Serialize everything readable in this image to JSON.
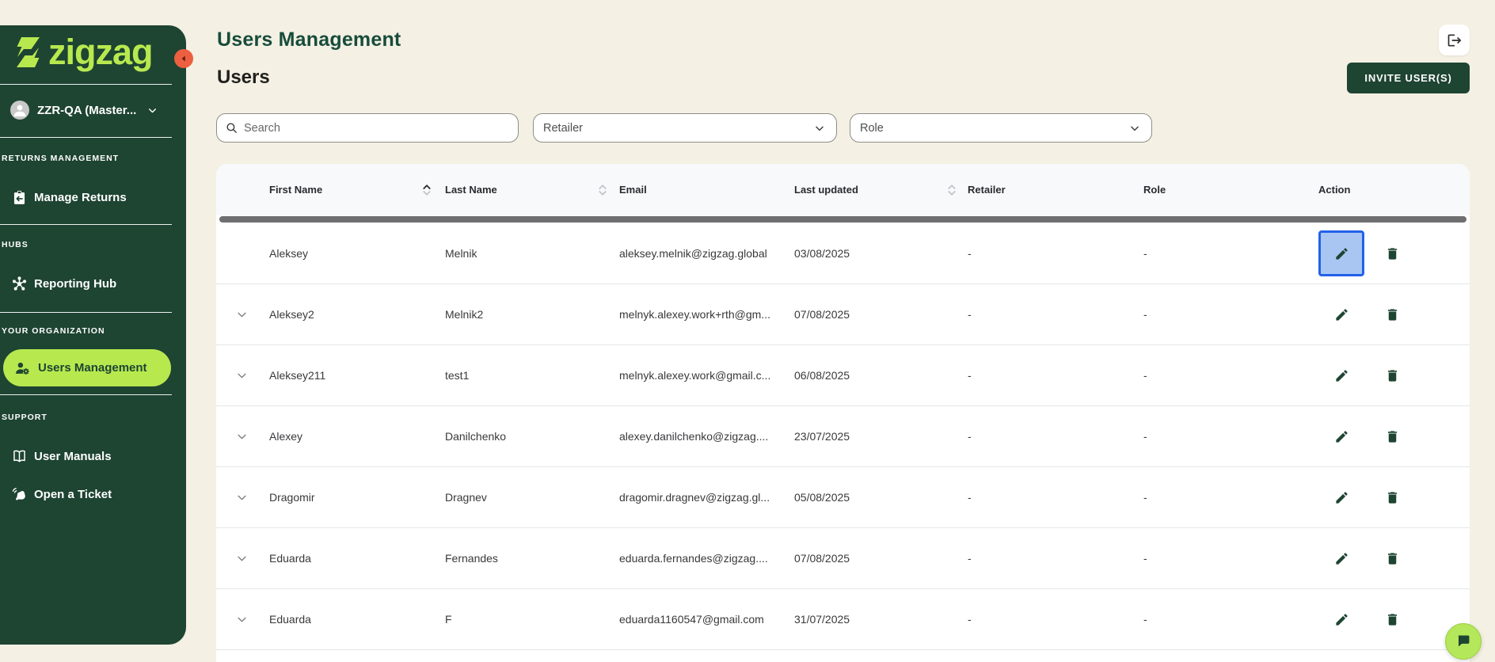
{
  "colors": {
    "sidebar_green": "#1e4432",
    "accent_green": "#b7e94f",
    "cream_bg": "#f4f0e3",
    "orange_collapse": "#ec5f41",
    "highlight_blue_border": "#2261e9",
    "highlight_blue_fill": "#a9c6f2",
    "title_green": "#174c3c"
  },
  "sidebar": {
    "logo_text": "zigzag",
    "account": {
      "name": "ZZR-QA (Master..."
    },
    "sections": [
      {
        "label": "RETURNS MANAGEMENT",
        "items": [
          {
            "label": "Manage Returns",
            "icon": "returns-box-icon",
            "active": false
          }
        ]
      },
      {
        "label": "HUBS",
        "items": [
          {
            "label": "Reporting Hub",
            "icon": "hub-icon",
            "active": false
          }
        ]
      },
      {
        "label": "YOUR ORGANIZATION",
        "items": [
          {
            "label": "Users Management",
            "icon": "user-gear-icon",
            "active": true
          }
        ]
      },
      {
        "label": "SUPPORT",
        "items": [
          {
            "label": "User Manuals",
            "icon": "book-icon",
            "active": false
          },
          {
            "label": "Open a Ticket",
            "icon": "ticket-icon",
            "active": false
          }
        ]
      }
    ]
  },
  "header": {
    "title": "Users Management",
    "subtitle": "Users",
    "invite_button": "INVITE USER(S)"
  },
  "filters": {
    "search_placeholder": "Search",
    "retailer_label": "Retailer",
    "role_label": "Role"
  },
  "table": {
    "columns": [
      {
        "label": "First Name",
        "sortable": true,
        "sort": "asc"
      },
      {
        "label": "Last Name",
        "sortable": true,
        "sort": "none"
      },
      {
        "label": "Email",
        "sortable": false,
        "sort": "none"
      },
      {
        "label": "Last updated",
        "sortable": true,
        "sort": "none"
      },
      {
        "label": "Retailer",
        "sortable": false,
        "sort": "none"
      },
      {
        "label": "Role",
        "sortable": false,
        "sort": "none"
      },
      {
        "label": "Action",
        "sortable": false,
        "sort": "none"
      }
    ],
    "rows": [
      {
        "first": "Aleksey",
        "last": "Melnik",
        "email": "aleksey.melnik@zigzag.global",
        "updated": "03/08/2025",
        "retailer": "-",
        "role": "-",
        "expandable": false,
        "edit_highlighted": true
      },
      {
        "first": "Aleksey2",
        "last": "Melnik2",
        "email": "melnyk.alexey.work+rth@gm...",
        "updated": "07/08/2025",
        "retailer": "-",
        "role": "-",
        "expandable": true,
        "edit_highlighted": false
      },
      {
        "first": "Aleksey211",
        "last": "test1",
        "email": "melnyk.alexey.work@gmail.c...",
        "updated": "06/08/2025",
        "retailer": "-",
        "role": "-",
        "expandable": true,
        "edit_highlighted": false
      },
      {
        "first": "Alexey",
        "last": "Danilchenko",
        "email": "alexey.danilchenko@zigzag....",
        "updated": "23/07/2025",
        "retailer": "-",
        "role": "-",
        "expandable": true,
        "edit_highlighted": false
      },
      {
        "first": "Dragomir",
        "last": "Dragnev",
        "email": "dragomir.dragnev@zigzag.gl...",
        "updated": "05/08/2025",
        "retailer": "-",
        "role": "-",
        "expandable": true,
        "edit_highlighted": false
      },
      {
        "first": "Eduarda",
        "last": "Fernandes",
        "email": "eduarda.fernandes@zigzag....",
        "updated": "07/08/2025",
        "retailer": "-",
        "role": "-",
        "expandable": true,
        "edit_highlighted": false
      },
      {
        "first": "Eduarda",
        "last": "F",
        "email": "eduarda1160547@gmail.com",
        "updated": "31/07/2025",
        "retailer": "-",
        "role": "-",
        "expandable": true,
        "edit_highlighted": false
      }
    ]
  }
}
